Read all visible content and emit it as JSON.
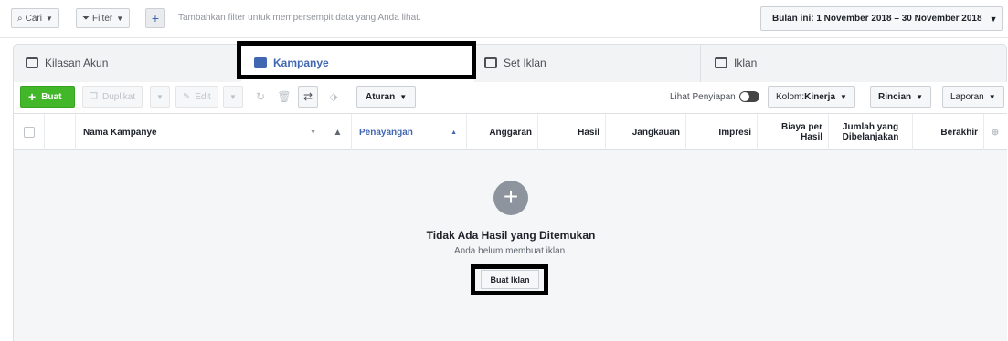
{
  "filterbar": {
    "search_label": "Cari",
    "filter_label": "Filter",
    "plus_label": "+",
    "hint": "Tambahkan filter untuk mempersempit data yang Anda lihat.",
    "date_label": "Bulan ini: 1 November 2018 – 30 November 2018"
  },
  "tabs": [
    {
      "label": "Kilasan Akun",
      "icon": "account-overview-icon"
    },
    {
      "label": "Kampanye",
      "icon": "folder-icon",
      "active": true
    },
    {
      "label": "Set Iklan",
      "icon": "grid-icon"
    },
    {
      "label": "Iklan",
      "icon": "ad-icon"
    }
  ],
  "toolbar": {
    "create_label": "Buat",
    "duplicate_label": "Duplikat",
    "edit_label": "Edit",
    "rules_label": "Aturan",
    "preview_label": "Lihat Penyiapan",
    "columns_prefix": "Kolom: ",
    "columns_value": "Kinerja",
    "breakdown_label": "Rincian",
    "reports_label": "Laporan"
  },
  "table": {
    "headers": {
      "name": "Nama Kampanye",
      "delivery": "Penayangan",
      "budget": "Anggaran",
      "results": "Hasil",
      "reach": "Jangkauan",
      "impressions": "Impresi",
      "cost_per_result": "Biaya per Hasil",
      "amount_spent": "Jumlah yang Dibelanjakan",
      "ends": "Berakhir"
    }
  },
  "empty": {
    "title": "Tidak Ada Hasil yang Ditemukan",
    "subtitle": "Anda belum membuat iklan.",
    "button_label": "Buat Iklan"
  },
  "colors": {
    "accent": "#4267b2",
    "create_green": "#42b72a"
  }
}
